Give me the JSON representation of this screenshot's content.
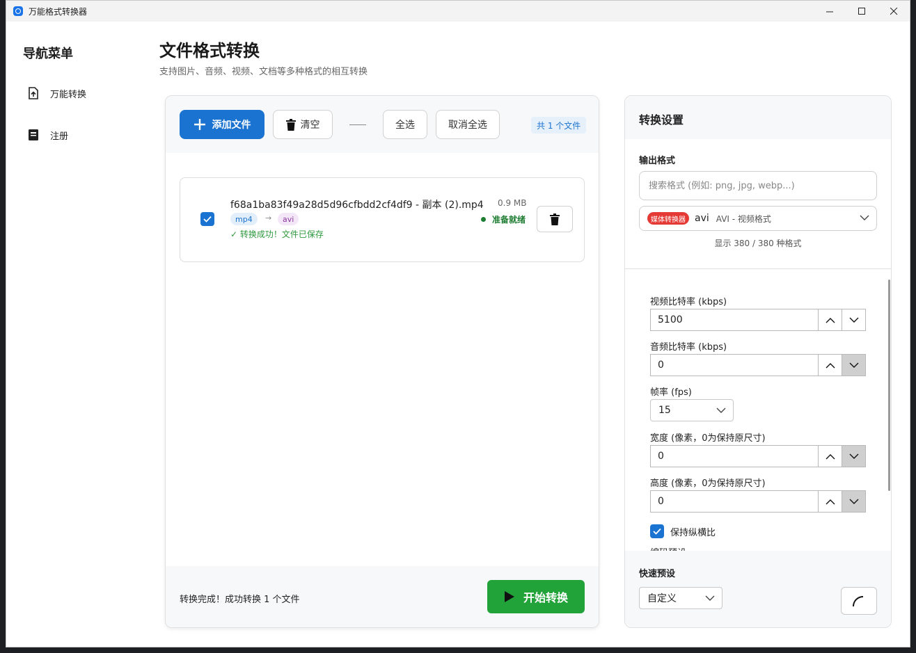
{
  "window": {
    "title": "万能格式转换器",
    "controls": {
      "minimize": "—",
      "maximize": "☐",
      "close": "✕"
    }
  },
  "sidebar": {
    "title": "导航菜单",
    "items": [
      {
        "label": "万能转换",
        "icon": "file-upload-icon"
      },
      {
        "label": "注册",
        "icon": "book-icon"
      }
    ]
  },
  "header": {
    "title": "文件格式转换",
    "subtitle": "支持图片、音频、视频、文档等多种格式的相互转换"
  },
  "toolbar": {
    "add_label": "添加文件",
    "clear_label": "清空",
    "select_all_label": "全选",
    "deselect_all_label": "取消全选",
    "count_label": "共 1 个文件"
  },
  "files": [
    {
      "name": "f68a1ba83f49a28d5d96cfbdd2cf4df9 - 副本 (2).mp4",
      "size": "0.9 MB",
      "src_format": "mp4",
      "dst_format": "avi",
      "arrow": "→",
      "status": "准备就绪",
      "message": "✓ 转换成功！文件已保存",
      "checked": true
    }
  ],
  "footer": {
    "status": "转换完成！成功转换 1 个文件",
    "start_label": "开始转换"
  },
  "settings": {
    "title": "转换设置",
    "output_format_label": "输出格式",
    "search_placeholder": "搜索格式 (例如: png, jpg, webp...)",
    "selected_badge": "媒体转换器",
    "selected_code": "avi",
    "selected_desc": "AVI - 视频格式",
    "format_count": "显示 380 / 380 种格式",
    "video_bitrate_label": "视频比特率 (kbps)",
    "video_bitrate": "5100",
    "audio_bitrate_label": "音频比特率 (kbps)",
    "audio_bitrate": "0",
    "fps_label": "帧率 (fps)",
    "fps": "15",
    "width_label": "宽度 (像素，0为保持原尺寸)",
    "width": "0",
    "height_label": "高度 (像素，0为保持原尺寸)",
    "height": "0",
    "keep_ratio_label": "保持纵横比",
    "keep_ratio": true,
    "cut_label": "编码预设",
    "quick_preset_label": "快速预设",
    "quick_preset": "自定义"
  },
  "colors": {
    "primary": "#1a73d0",
    "success": "#22a33a",
    "danger": "#e53935"
  }
}
